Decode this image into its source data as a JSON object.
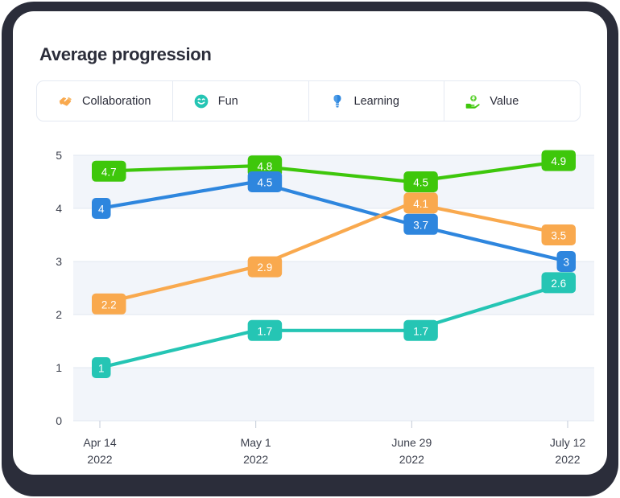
{
  "card": {
    "title": "Average progression"
  },
  "tabs": [
    {
      "label": "Collaboration",
      "icon": "handshake-icon",
      "color": "#F9A94E",
      "key": "collaboration"
    },
    {
      "label": "Fun",
      "icon": "smiley-face-icon",
      "color": "#25C5B4",
      "key": "fun"
    },
    {
      "label": "Learning",
      "icon": "lightbulb-icon",
      "color": "#2E86DE",
      "key": "learning"
    },
    {
      "label": "Value",
      "icon": "hand-money-icon",
      "color": "#3EC70B",
      "key": "value"
    }
  ],
  "chart_data": {
    "type": "line",
    "title": "Average progression",
    "xlabel": "",
    "ylabel": "",
    "ylim": [
      0,
      5
    ],
    "yticks": [
      "0",
      "1",
      "2",
      "3",
      "4",
      "5"
    ],
    "grid": true,
    "legend_position": "top",
    "banded_background": true,
    "categories": [
      "Apr 14\n2022",
      "May 1\n2022",
      "June 29\n2022",
      "July 12\n2022"
    ],
    "x_tick_lines": [
      {
        "line1": "Apr 14",
        "line2": "2022"
      },
      {
        "line1": "May 1",
        "line2": "2022"
      },
      {
        "line1": "June 29",
        "line2": "2022"
      },
      {
        "line1": "July 12",
        "line2": "2022"
      }
    ],
    "series": [
      {
        "name": "Value",
        "color": "#3EC70B",
        "values": [
          4.7,
          4.8,
          4.5,
          4.9
        ],
        "labels": [
          "4.7",
          "4.8",
          "4.5",
          "4.9"
        ]
      },
      {
        "name": "Learning",
        "color": "#2E86DE",
        "values": [
          4,
          4.5,
          3.7,
          3
        ],
        "labels": [
          "4",
          "4.5",
          "3.7",
          "3"
        ]
      },
      {
        "name": "Collaboration",
        "color": "#F9A94E",
        "values": [
          2.2,
          2.9,
          4.1,
          3.5
        ],
        "labels": [
          "2.2",
          "2.9",
          "4.1",
          "3.5"
        ]
      },
      {
        "name": "Fun",
        "color": "#25C5B4",
        "values": [
          1,
          1.7,
          1.7,
          2.6
        ],
        "labels": [
          "1",
          "1.7",
          "1.7",
          "2.6"
        ]
      }
    ]
  }
}
